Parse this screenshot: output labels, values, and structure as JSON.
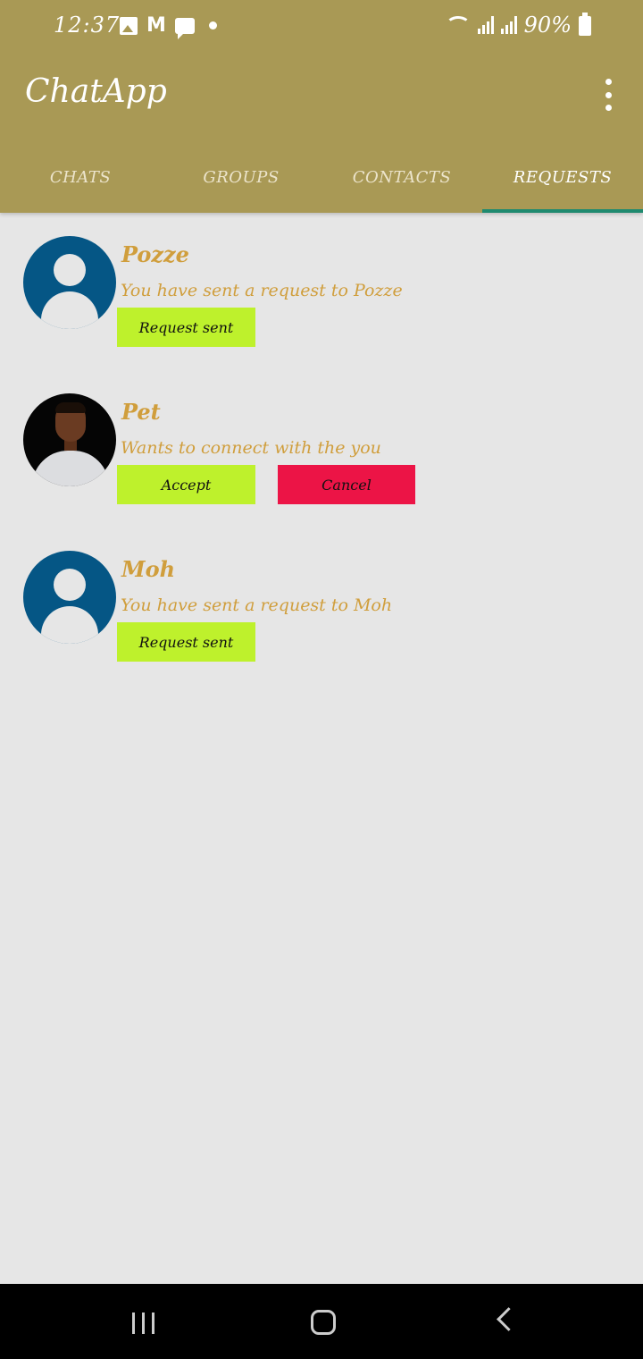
{
  "status_bar": {
    "time": "12:37",
    "battery": "90%"
  },
  "app": {
    "title": "ChatApp"
  },
  "tabs": [
    {
      "label": "CHATS",
      "active": false
    },
    {
      "label": "GROUPS",
      "active": false
    },
    {
      "label": "CONTACTS",
      "active": false
    },
    {
      "label": "REQUESTS",
      "active": true
    }
  ],
  "requests": [
    {
      "name": "Pozze",
      "message": "You have sent a request to Pozze",
      "avatar": "default-avatar",
      "buttons": [
        {
          "label": "Request sent",
          "color": "#bef12c"
        }
      ]
    },
    {
      "name": "Pet",
      "message": "Wants to connect with the you",
      "avatar": "profile-photo",
      "buttons": [
        {
          "label": "Accept",
          "color": "#bef12c"
        },
        {
          "label": "Cancel",
          "color": "#ec1446"
        }
      ]
    },
    {
      "name": "Moh",
      "message": "You have sent a request to Moh",
      "avatar": "default-avatar",
      "buttons": [
        {
          "label": "Request sent",
          "color": "#bef12c"
        }
      ]
    }
  ],
  "colors": {
    "appbar": "#a99955",
    "accent_indicator": "#1f8a6f",
    "name_text": "#d09e3c",
    "background": "#e6e6e6",
    "avatar_bg": "#055685"
  }
}
